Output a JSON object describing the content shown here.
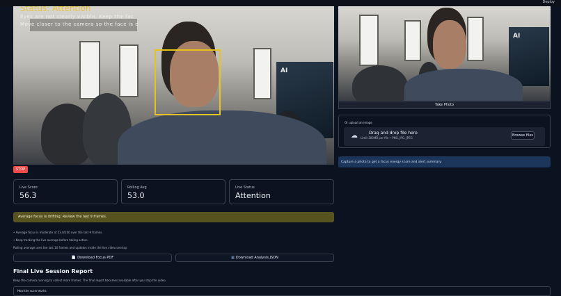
{
  "header": {
    "deploy_label": "Deploy"
  },
  "live_feed": {
    "status_title": "Status: Attention",
    "message_line1": "Eyes are not clearly visible. Keep the fac",
    "message_line2": "Move closer to the camera so the face is e",
    "poster_text": "AI"
  },
  "controls": {
    "stop_label": "STOP"
  },
  "metrics": [
    {
      "label": "Live Score",
      "value": "56.3"
    },
    {
      "label": "Rolling Avg",
      "value": "53.0"
    },
    {
      "label": "Live Status",
      "value": "Attention"
    }
  ],
  "alert": {
    "warning": "Average focus is drifting. Review the last 9 frames."
  },
  "notes": {
    "line1": "• Average focus is moderate at 53.0/100 over the last 9 frames.",
    "line2": "• Keep tracking the live average before taking action.",
    "caption": "Rolling average uses the last 10 frames and updates inside the live video overlay."
  },
  "downloads": {
    "pdf_label": "Download Focus PDF",
    "json_label": "Download Analysis JSON"
  },
  "report": {
    "title": "Final Live Session Report",
    "subtitle": "Keep the camera running to collect more frames. The final report becomes available after you stop the video.",
    "expander_label": "How the score works"
  },
  "camera_input": {
    "take_photo_label": "Take Photo",
    "poster_text": "AI"
  },
  "uploader": {
    "label": "Or upload an image",
    "drop_text": "Drag and drop file here",
    "limit_text": "Limit 200MB per file • PNG, JPG, JPEG",
    "browse_label": "Browse files"
  },
  "info": {
    "message": "Capture a photo to get a focus energy score and alert summary."
  },
  "colors": {
    "background": "#0b1220",
    "face_box": "#e8c21e",
    "status_text": "#e7c23c",
    "stop_button": "#ef4b4b",
    "warning_bg": "#56531e",
    "info_bg": "#1c355a"
  },
  "icons": [
    "file-icon",
    "json-icon",
    "cloud-upload-icon",
    "chevron-down-icon"
  ]
}
